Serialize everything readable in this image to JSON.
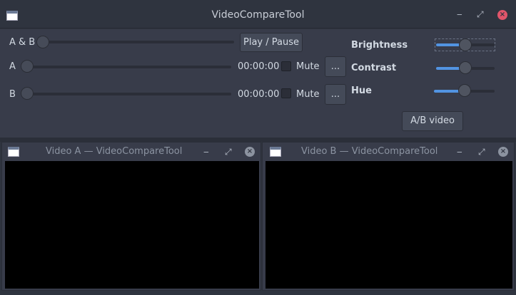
{
  "main_window": {
    "title": "VideoCompareTool",
    "controls": {
      "minimize": "‒",
      "maximize": "⤢",
      "close": "×"
    }
  },
  "sliders": {
    "ab": {
      "label": "A & B",
      "value": 0
    },
    "a": {
      "label": "A",
      "value": 0,
      "time": "00:00:00",
      "mute_label": "Mute",
      "mute_checked": false,
      "browse_label": "..."
    },
    "b": {
      "label": "B",
      "value": 0,
      "time": "00:00:00",
      "mute_label": "Mute",
      "mute_checked": false,
      "browse_label": "..."
    }
  },
  "buttons": {
    "play_pause": "Play / Pause",
    "ab_video": "A/B video"
  },
  "adjustments": {
    "brightness": {
      "label": "Brightness",
      "value": 0.5
    },
    "contrast": {
      "label": "Contrast",
      "value": 0.5
    },
    "hue": {
      "label": "Hue",
      "value": 0.5
    }
  },
  "video_a_window": {
    "title": "Video A — VideoCompareTool",
    "controls": {
      "minimize": "‒",
      "maximize": "⤢",
      "close": "×"
    }
  },
  "video_b_window": {
    "title": "Video B — VideoCompareTool",
    "controls": {
      "minimize": "‒",
      "maximize": "⤢",
      "close": "×"
    }
  },
  "colors": {
    "accent": "#5294e2",
    "window_bg": "#383c4a",
    "titlebar_bg": "#2f343f",
    "close_red": "#e0556a",
    "video_bg": "#000000"
  }
}
